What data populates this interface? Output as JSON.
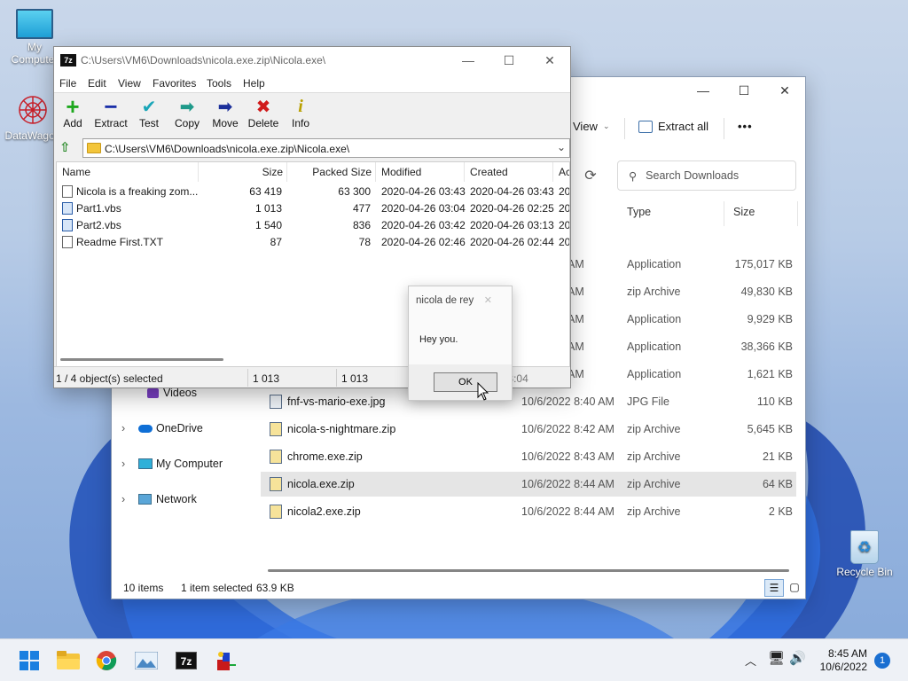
{
  "colors": {
    "explorer_selected_row": "#e5e5e5",
    "taskbar_bg": "#eef1f6",
    "accent_blue": "#1a6fd1"
  },
  "desktop": {
    "icons": [
      {
        "label": "My Computer",
        "icon": "monitor-icon"
      },
      {
        "label": "DataWagon",
        "icon": "datawagon-icon"
      },
      {
        "label": "Recycle Bin",
        "icon": "recycle-bin-icon"
      }
    ]
  },
  "explorer": {
    "toolbar": {
      "view": "View",
      "extract_all": "Extract all",
      "more": "•••"
    },
    "search_placeholder": "Search Downloads",
    "columns": {
      "type": "Type",
      "size": "Size"
    },
    "nav": [
      {
        "label": "Videos"
      },
      {
        "label": "OneDrive"
      },
      {
        "label": "My Computer"
      },
      {
        "label": "Network"
      }
    ],
    "rows": [
      {
        "name": "",
        "date": "",
        "time_fragment": "AM",
        "type": "Application",
        "size": "175,017 KB"
      },
      {
        "name": "",
        "date": "",
        "time_fragment": "AM",
        "type": "zip Archive",
        "size": "49,830 KB"
      },
      {
        "name": "",
        "date": "",
        "time_fragment": "AM",
        "type": "Application",
        "size": "9,929 KB"
      },
      {
        "name": "",
        "date": "",
        "time_fragment": "AM",
        "type": "Application",
        "size": "38,366 KB"
      },
      {
        "name": "",
        "date": "",
        "time_fragment": "AM",
        "type": "Application",
        "size": "1,621 KB"
      },
      {
        "name": "fnf-vs-mario-exe.jpg",
        "date": "10/6/2022 8:40 AM",
        "type": "JPG File",
        "size": "110 KB"
      },
      {
        "name": "nicola-s-nightmare.zip",
        "date": "10/6/2022 8:42 AM",
        "type": "zip Archive",
        "size": "5,645 KB"
      },
      {
        "name": "chrome.exe.zip",
        "date": "10/6/2022 8:43 AM",
        "type": "zip Archive",
        "size": "21 KB"
      },
      {
        "name": "nicola.exe.zip",
        "date": "10/6/2022 8:44 AM",
        "type": "zip Archive",
        "size": "64 KB"
      },
      {
        "name": "nicola2.exe.zip",
        "date": "10/6/2022 8:44 AM",
        "type": "zip Archive",
        "size": "2 KB"
      }
    ],
    "status": {
      "count": "10 items",
      "selected": "1 item selected",
      "size": "63.9 KB"
    }
  },
  "zip": {
    "title": "C:\\Users\\VM6\\Downloads\\nicola.exe.zip\\Nicola.exe\\",
    "badge": "7z",
    "menu": [
      "File",
      "Edit",
      "View",
      "Favorites",
      "Tools",
      "Help"
    ],
    "tools": [
      "Add",
      "Extract",
      "Test",
      "Copy",
      "Move",
      "Delete",
      "Info"
    ],
    "path": "C:\\Users\\VM6\\Downloads\\nicola.exe.zip\\Nicola.exe\\",
    "columns": {
      "name": "Name",
      "size": "Size",
      "packed": "Packed Size",
      "modified": "Modified",
      "created": "Created",
      "accessed": "Ac"
    },
    "files": [
      {
        "name": "Nicola is a freaking zom...",
        "size": "63 419",
        "packed": "63 300",
        "modified": "2020-04-26 03:43",
        "created": "2020-04-26 03:43",
        "acc": "20"
      },
      {
        "name": "Part1.vbs",
        "size": "1 013",
        "packed": "477",
        "modified": "2020-04-26 03:04",
        "created": "2020-04-26 02:25",
        "acc": "20"
      },
      {
        "name": "Part2.vbs",
        "size": "1 540",
        "packed": "836",
        "modified": "2020-04-26 03:42",
        "created": "2020-04-26 03:13",
        "acc": "20"
      },
      {
        "name": "Readme First.TXT",
        "size": "87",
        "packed": "78",
        "modified": "2020-04-26 02:46",
        "created": "2020-04-26 02:44",
        "acc": "20"
      }
    ],
    "status": {
      "selection": "1 / 4 object(s) selected",
      "size": "1 013",
      "packed": "1 013",
      "extra": "2020-04-26 03:04"
    }
  },
  "dialog": {
    "title": "nicola de rey",
    "message": "Hey you.",
    "ok": "OK"
  },
  "taskbar": {
    "apps": [
      "windows-start-icon",
      "file-explorer-icon",
      "chrome-icon",
      "picture-icon",
      "7zip-icon",
      "app-icon"
    ],
    "time": "8:45 AM",
    "date": "10/6/2022",
    "notifications": "1"
  }
}
